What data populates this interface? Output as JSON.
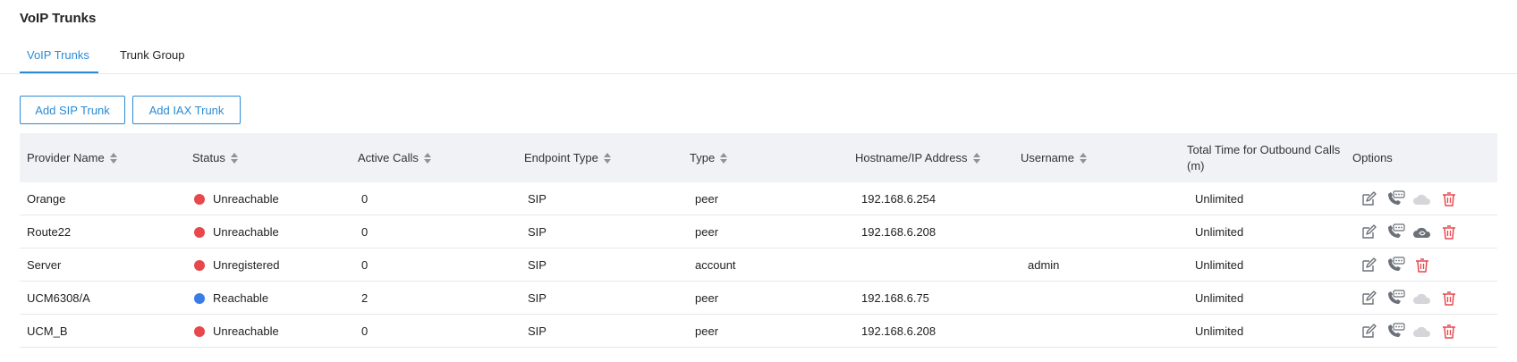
{
  "page": {
    "title": "VoIP Trunks"
  },
  "tabs": [
    {
      "label": "VoIP Trunks",
      "active": true
    },
    {
      "label": "Trunk Group",
      "active": false
    }
  ],
  "buttons": {
    "add_sip": "Add SIP Trunk",
    "add_iax": "Add IAX Trunk"
  },
  "columns": {
    "provider_name": "Provider Name",
    "status": "Status",
    "active_calls": "Active Calls",
    "endpoint_type": "Endpoint Type",
    "type": "Type",
    "hostname": "Hostname/IP Address",
    "username": "Username",
    "total_time": "Total Time for Outbound Calls (m)",
    "options": "Options"
  },
  "colors": {
    "accent": "#2a8bd4",
    "status_red": "#e8474c",
    "status_blue": "#3b7be6",
    "delete_red": "#e8474c",
    "icon_gray": "#6b7178",
    "cloud_disabled": "#d4d6d9"
  },
  "rows": [
    {
      "provider": "Orange",
      "status": "Unreachable",
      "status_color": "red",
      "active_calls": "0",
      "endpoint_type": "SIP",
      "type": "peer",
      "hostname": "192.168.6.254",
      "username": "",
      "total_time": "Unlimited",
      "options": [
        "edit-icon",
        "call-detail-icon",
        "cloud-icon-disabled",
        "delete-icon"
      ]
    },
    {
      "provider": "Route22",
      "status": "Unreachable",
      "status_color": "red",
      "active_calls": "0",
      "endpoint_type": "SIP",
      "type": "peer",
      "hostname": "192.168.6.208",
      "username": "",
      "total_time": "Unlimited",
      "options": [
        "edit-icon",
        "call-detail-icon",
        "cloud-sync-icon",
        "delete-icon"
      ]
    },
    {
      "provider": "Server",
      "status": "Unregistered",
      "status_color": "red",
      "active_calls": "0",
      "endpoint_type": "SIP",
      "type": "account",
      "hostname": "",
      "username": "admin",
      "total_time": "Unlimited",
      "options": [
        "edit-icon",
        "call-detail-icon",
        "delete-icon"
      ]
    },
    {
      "provider": "UCM6308/A",
      "status": "Reachable",
      "status_color": "blue",
      "active_calls": "2",
      "endpoint_type": "SIP",
      "type": "peer",
      "hostname": "192.168.6.75",
      "username": "",
      "total_time": "Unlimited",
      "options": [
        "edit-icon",
        "call-detail-icon",
        "cloud-icon-disabled",
        "delete-icon"
      ]
    },
    {
      "provider": "UCM_B",
      "status": "Unreachable",
      "status_color": "red",
      "active_calls": "0",
      "endpoint_type": "SIP",
      "type": "peer",
      "hostname": "192.168.6.208",
      "username": "",
      "total_time": "Unlimited",
      "options": [
        "edit-icon",
        "call-detail-icon",
        "cloud-icon-disabled",
        "delete-icon"
      ]
    }
  ]
}
